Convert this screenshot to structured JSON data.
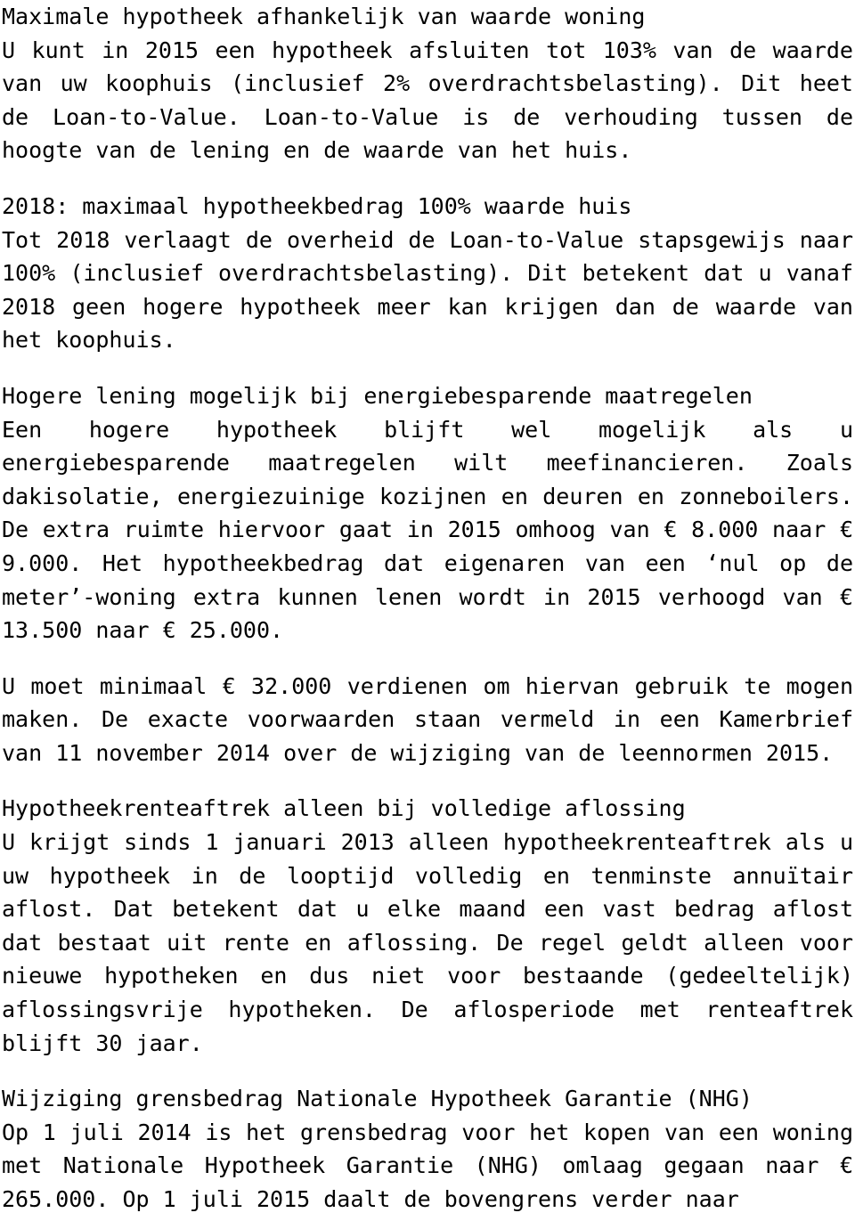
{
  "document": {
    "language": "nl",
    "text_color": "#000000",
    "background_color": "#ffffff",
    "sections": [
      {
        "id": "loan-to-value",
        "heading": "Maximale hypotheek afhankelijk van waarde woning",
        "body": "U kunt in 2015 een hypotheek afsluiten tot 103% van de waarde van uw koophuis (inclusief 2% overdrachtsbelasting). Dit heet de Loan-to-Value. Loan-to-Value is de verhouding tussen de hoogte van de lening en de waarde van het huis."
      },
      {
        "id": "2018-maximaal",
        "heading": "2018: maximaal hypotheekbedrag 100% waarde huis",
        "body": "Tot 2018 verlaagt de overheid de Loan-to-Value stapsgewijs naar 100% (inclusief overdrachtsbelasting). Dit betekent dat u vanaf 2018 geen hogere hypotheek meer kan krijgen dan de waarde van het koophuis."
      },
      {
        "id": "energiebesparende-maatregelen",
        "heading": "Hogere lening mogelijk bij energiebesparende maatregelen",
        "body": "Een hogere hypotheek blijft wel mogelijk als u energiebesparende maatregelen wilt meefinancieren. Zoals dakisolatie, energiezuinige kozijnen en deuren en zonneboilers. De extra ruimte hiervoor gaat in 2015 omhoog van € 8.000 naar € 9.000. Het hypotheekbedrag dat eigenaren van een ‘nul op de meter’-woning extra kunnen lenen wordt in 2015 verhoogd van € 13.500 naar € 25.000."
      },
      {
        "id": "minimaal-inkomen",
        "heading": null,
        "body": "U moet minimaal € 32.000 verdienen om hiervan gebruik te mogen maken. De exacte voorwaarden staan vermeld in een Kamerbrief van 11 november 2014 over de wijziging van de leennormen 2015."
      },
      {
        "id": "hypotheekrenteaftrek",
        "heading": "Hypotheekrenteaftrek alleen bij volledige aflossing",
        "body": "U krijgt sinds 1 januari 2013 alleen hypotheekrenteaftrek als u uw hypotheek in de looptijd volledig en tenminste annuïtair aflost. Dat betekent dat u elke maand een vast bedrag aflost dat bestaat uit rente en aflossing. De regel geldt alleen voor nieuwe hypotheken en dus niet voor bestaande (gedeeltelijk) aflossingsvrije hypotheken. De aflosperiode met renteaftrek blijft 30 jaar."
      },
      {
        "id": "nhg-grensbedrag",
        "heading": "Wijziging grensbedrag Nationale Hypotheek Garantie (NHG)",
        "body": "Op 1 juli 2014 is het grensbedrag voor het kopen van een woning met Nationale Hypotheek Garantie (NHG) omlaag gegaan naar € 265.000. Op 1 juli 2015 daalt de bovengrens verder naar"
      }
    ]
  }
}
